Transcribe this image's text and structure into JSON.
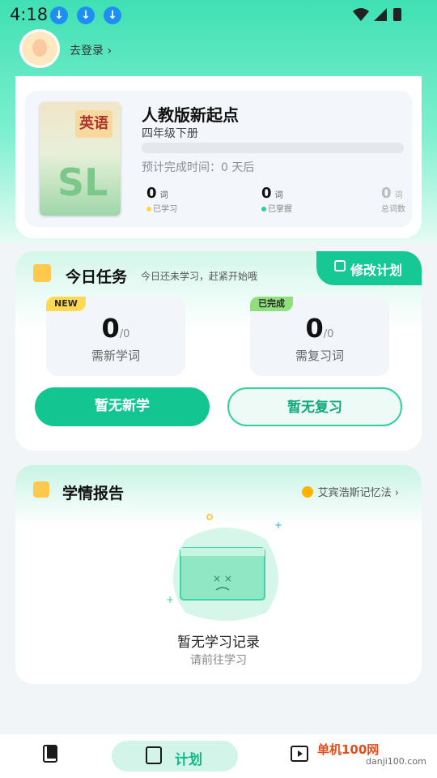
{
  "status_bar": {
    "time": "4:18"
  },
  "user": {
    "login_label": "去登录 ›"
  },
  "book": {
    "title": "人教版新起点",
    "grade": "四年级下册",
    "cover_title": "英语",
    "progress": 0,
    "eta": "预计完成时间：0 天后",
    "stats": [
      {
        "value": "0",
        "unit": "词",
        "label": "已学习",
        "color": "#ffd54a"
      },
      {
        "value": "0",
        "unit": "词",
        "label": "已掌握",
        "color": "#2fcf9e"
      },
      {
        "value": "0",
        "unit": "词",
        "label": "总词数",
        "color": ""
      }
    ]
  },
  "tasks": {
    "title": "今日任务",
    "subtitle": "今日还未学习，赶紧开始哦",
    "edit_plan": "修改计划",
    "new": {
      "badge": "NEW",
      "value": "0",
      "total": "/0",
      "label": "需新学词"
    },
    "review": {
      "badge": "已完成",
      "value": "0",
      "total": "/0",
      "label": "需复习词"
    },
    "btn_new": "暂无新学",
    "btn_review": "暂无复习"
  },
  "report": {
    "title": "学情报告",
    "link": "艾宾浩斯记忆法",
    "empty_title": "暂无学习记录",
    "empty_sub": "请前往学习"
  },
  "nav": {
    "plan_label": "计划"
  },
  "watermark": {
    "text": "单机100网",
    "domain": "danji100.com"
  },
  "colors": {
    "accent": "#13c591",
    "badge_new": "#ffd94f",
    "badge_done": "#8fe07a"
  }
}
